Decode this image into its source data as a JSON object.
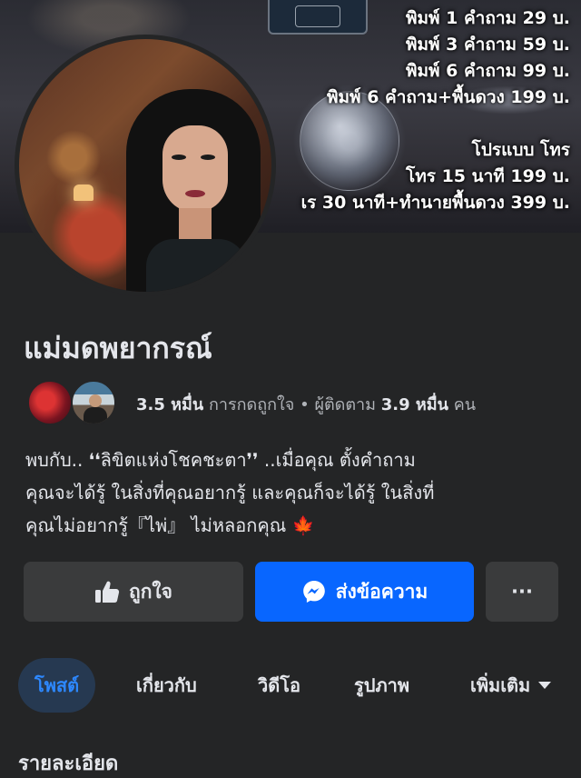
{
  "cover": {
    "prices": [
      "พิมพ์ 1 คำถาม 29 บ.",
      "พิมพ์ 3 คำถาม 59 บ.",
      "พิมพ์ 6 คำถาม 99 บ.",
      "พิมพ์ 6 คำถาม+พื้นดวง 199 บ."
    ],
    "call_title": "โปรแบบ โทร",
    "call_prices": [
      "โทร 15 นาที  199 บ.",
      "เร 30 นาที+ทำนายพื้นดวง 399 บ."
    ]
  },
  "page": {
    "name": "แม่มดพยากรณ์"
  },
  "stats": {
    "likes_value": "3.5 หมื่น",
    "likes_label": "การกดถูกใจ",
    "separator": "•",
    "followers_label": "ผู้ติดตาม",
    "followers_value": "3.9 หมื่น",
    "followers_suffix": "คน"
  },
  "bio": {
    "line1": "พบกับ.. ❛❛ลิขิตแห่งโชคชะตา❜❜ ..เมื่อคุณ ตั้งคำถาม",
    "line2": "คุณจะได้รู้ ในสิ่งที่คุณอยากรู้ และคุณก็จะได้รู้ ในสิ่งที่",
    "line3": "คุณไม่อยากรู้『ไพ่』 ไม่หลอกคุณ 🍁"
  },
  "actions": {
    "like_label": "ถูกใจ",
    "message_label": "ส่งข้อความ",
    "more_label": "···"
  },
  "tabs": {
    "posts": "โพสต์",
    "about": "เกี่ยวกับ",
    "videos": "วิดีโอ",
    "photos": "รูปภาพ",
    "more": "เพิ่มเติม"
  },
  "details": {
    "title": "รายละเอียด"
  },
  "colors": {
    "background": "#242526",
    "primary_blue": "#0866ff",
    "tab_active_bg": "#263951",
    "tab_active_text": "#2d88ff",
    "button_gray": "#3a3b3c"
  }
}
